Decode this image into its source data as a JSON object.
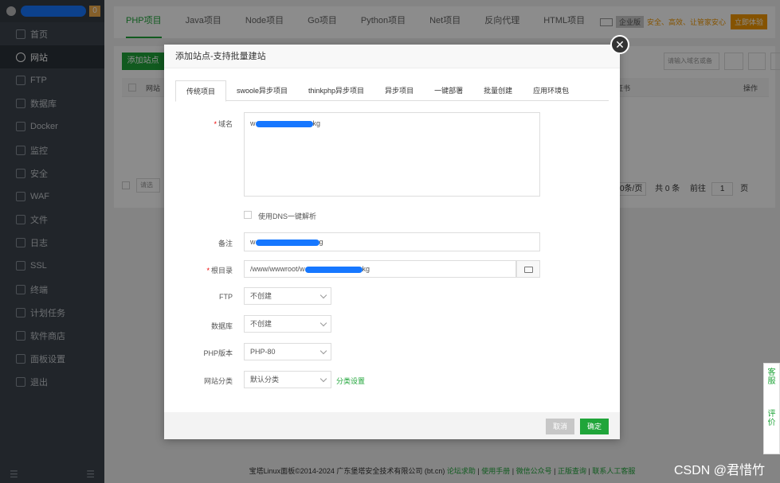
{
  "sidebar": {
    "badge": "0",
    "items": [
      {
        "label": "首页",
        "icon": "home-icon"
      },
      {
        "label": "网站",
        "icon": "globe-icon",
        "active": true
      },
      {
        "label": "FTP",
        "icon": "ftp-icon"
      },
      {
        "label": "数据库",
        "icon": "database-icon"
      },
      {
        "label": "Docker",
        "icon": "docker-icon"
      },
      {
        "label": "监控",
        "icon": "monitor-icon"
      },
      {
        "label": "安全",
        "icon": "shield-icon"
      },
      {
        "label": "WAF",
        "icon": "waf-icon"
      },
      {
        "label": "文件",
        "icon": "folder-icon"
      },
      {
        "label": "日志",
        "icon": "log-icon"
      },
      {
        "label": "SSL",
        "icon": "ssl-icon"
      },
      {
        "label": "终端",
        "icon": "terminal-icon"
      },
      {
        "label": "计划任务",
        "icon": "cron-icon"
      },
      {
        "label": "软件商店",
        "icon": "store-icon"
      },
      {
        "label": "面板设置",
        "icon": "gear-icon"
      },
      {
        "label": "退出",
        "icon": "logout-icon"
      }
    ],
    "bottom_left": "☰",
    "bottom_right": "☰"
  },
  "top_tabs": [
    "PHP项目",
    "Java项目",
    "Node项目",
    "Go项目",
    "Python项目",
    "Net项目",
    "反向代理",
    "HTML项目"
  ],
  "promo": {
    "tag": "企业版",
    "text": "安全、高效、让管家安心",
    "button": "立即体验"
  },
  "content": {
    "add_button": "添加站点",
    "search_placeholder": "请输入域名或备",
    "col_site": "网站",
    "col_cert": "证书",
    "col_ops": "操作",
    "pager_size": "0条/页",
    "pager_total": "共 0 条",
    "pager_goto": "前往",
    "pager_page": "1",
    "pager_unit": "页",
    "batch": "请选"
  },
  "modal": {
    "title": "添加站点-支持批量建站",
    "tabs": [
      "传统项目",
      "swoole异步项目",
      "thinkphp异步项目",
      "异步项目",
      "一键部署",
      "批量创建",
      "应用环境包"
    ],
    "domain_label": "域名",
    "domain_prefix": "w",
    "domain_suffix": "kg",
    "dns_label": "使用DNS一键解析",
    "remark_label": "备注",
    "remark_prefix": "w",
    "remark_suffix": "g",
    "root_label": "根目录",
    "root_prefix": "/www/wwwroot/w",
    "root_suffix": "kg",
    "ftp_label": "FTP",
    "ftp_value": "不创建",
    "db_label": "数据库",
    "db_value": "不创建",
    "php_label": "PHP版本",
    "php_value": "PHP-80",
    "category_label": "网站分类",
    "category_value": "默认分类",
    "category_link": "分类设置",
    "cancel": "取消",
    "ok": "确定"
  },
  "footer": {
    "copyright": "宝塔Linux面板©2014-2024 广东堡塔安全技术有限公司 (bt.cn)",
    "links": [
      "论坛求助",
      "使用手册",
      "微信公众号",
      "正版查询",
      "联系人工客服"
    ]
  },
  "float": {
    "service": "客服",
    "review": "评价"
  },
  "watermark": "CSDN @君惜竹",
  "colors": {
    "accent": "#20a53a",
    "sidebar": "#3c444d",
    "promo": "#f39800"
  }
}
